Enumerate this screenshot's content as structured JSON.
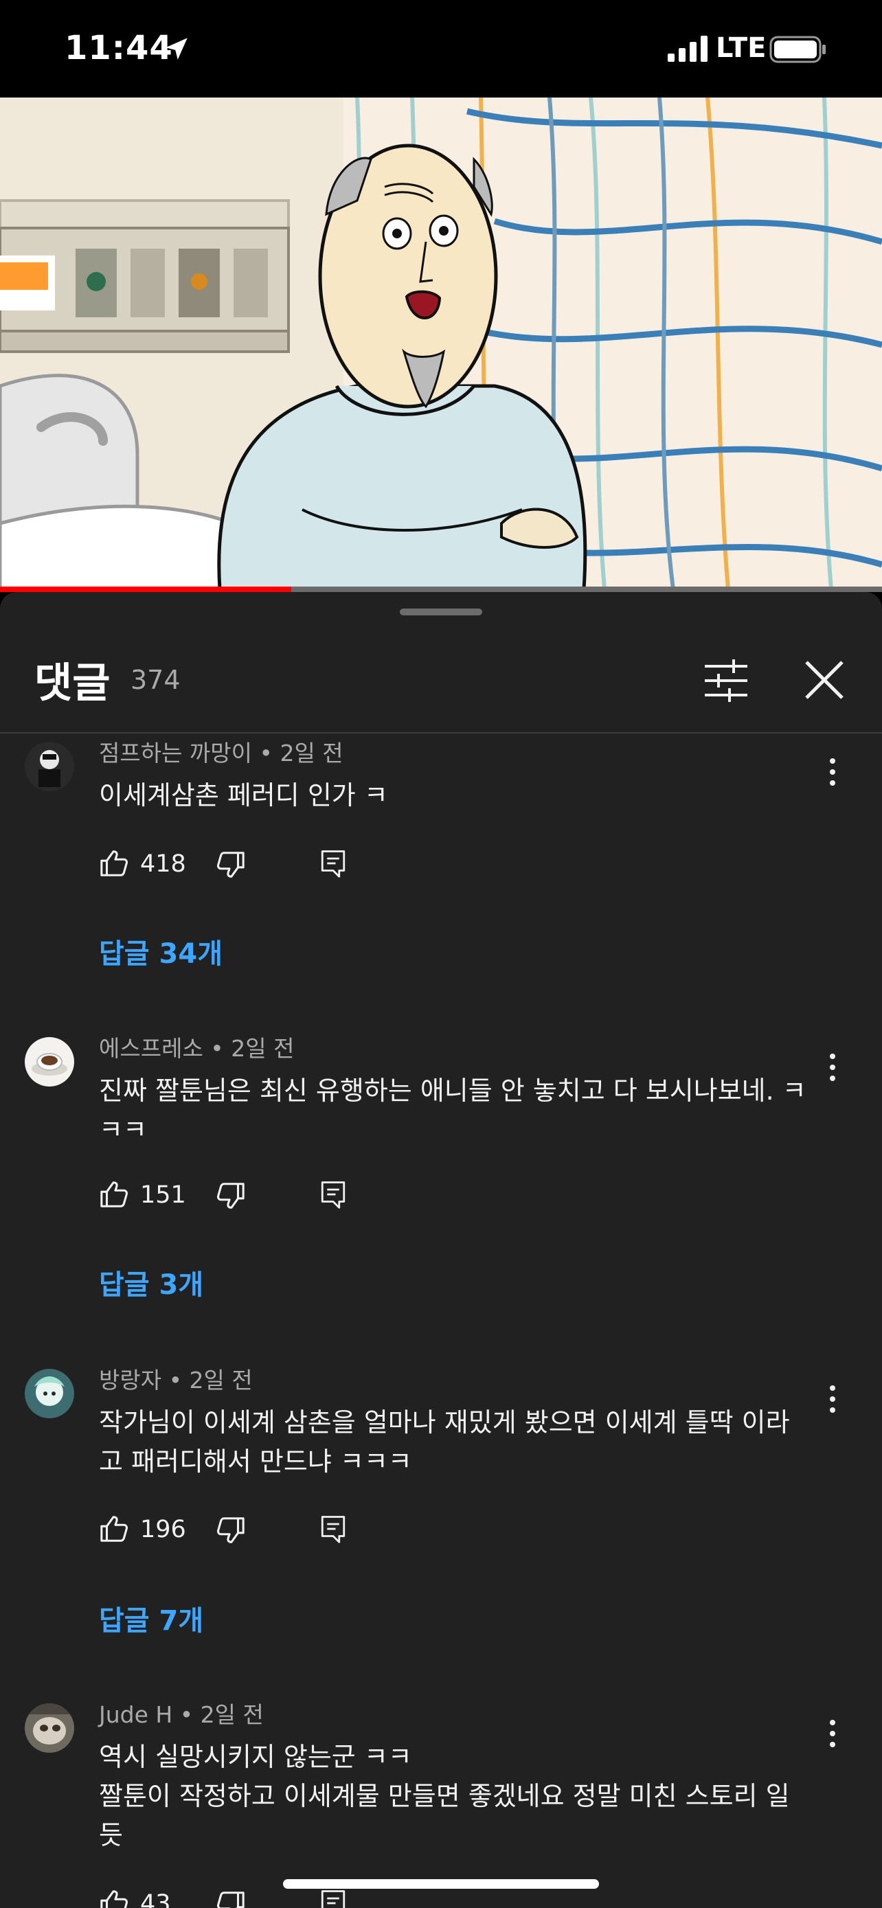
{
  "status_bar": {
    "time": "11:44",
    "network": "LTE"
  },
  "video": {
    "progress_fraction": 0.33
  },
  "comments_panel": {
    "title": "댓글",
    "count": "374",
    "filter_icon": "sliders-icon",
    "close_icon": "close-icon"
  },
  "comments": [
    {
      "author_line": "점프하는 까망이 • 2일 전",
      "text": "이세계삼촌 페러디 인가 ㅋ",
      "likes": "418",
      "replies": "답글 34개"
    },
    {
      "author_line": "에스프레소 • 2일 전",
      "text": "진짜 짤툰님은 최신 유행하는 애니들 안 놓치고 다 보시나보네. ㅋㅋㅋ",
      "likes": "151",
      "replies": "답글 3개"
    },
    {
      "author_line": "방랑자 • 2일 전",
      "text": "작가님이 이세계 삼촌을 얼마나 재밌게 봤으면 이세계 틀딱 이라고 패러디해서 만드냐 ㅋㅋㅋ",
      "likes": "196",
      "replies": "답글 7개"
    },
    {
      "author_line": "Jude H • 2일 전",
      "text": "역시 실망시키지 않는군 ㅋㅋ\n짤툰이 작정하고 이세계물 만들면 좋겠네요 정말 미친 스토리 일듯",
      "likes": "43",
      "replies": ""
    }
  ],
  "colors": {
    "accent_link": "#3ea6ff",
    "sheet_bg": "#212121",
    "progress": "#ff0000"
  }
}
